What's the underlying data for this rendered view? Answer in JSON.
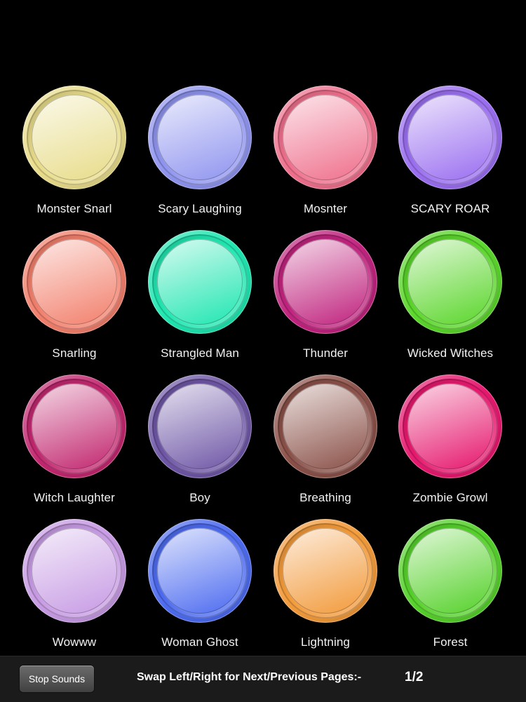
{
  "sounds": [
    {
      "label": "Monster Snarl",
      "color": "#e8dc8a"
    },
    {
      "label": "Scary Laughing",
      "color": "#8f94ef"
    },
    {
      "label": "Mosnter",
      "color": "#ef6f8c"
    },
    {
      "label": "SCARY ROAR",
      "color": "#9a6ef0"
    },
    {
      "label": "Snarling",
      "color": "#f27f6c"
    },
    {
      "label": "Strangled Man",
      "color": "#1fe6b0"
    },
    {
      "label": "Thunder",
      "color": "#c0237e"
    },
    {
      "label": "Wicked Witches",
      "color": "#5ad62a"
    },
    {
      "label": "Witch Laughter",
      "color": "#c2276f"
    },
    {
      "label": "Boy",
      "color": "#6e56a6"
    },
    {
      "label": "Breathing",
      "color": "#8a5048"
    },
    {
      "label": "Zombie Growl",
      "color": "#e6186e"
    },
    {
      "label": "Wowww",
      "color": "#c79be4"
    },
    {
      "label": "Woman Ghost",
      "color": "#4d6bf0"
    },
    {
      "label": "Lightning",
      "color": "#f29a3a"
    },
    {
      "label": "Forest",
      "color": "#55d12a"
    }
  ],
  "footer": {
    "stop_label": "Stop Sounds",
    "swap_text": "Swap Left/Right for Next/Previous Pages:-",
    "page": "1/2"
  }
}
